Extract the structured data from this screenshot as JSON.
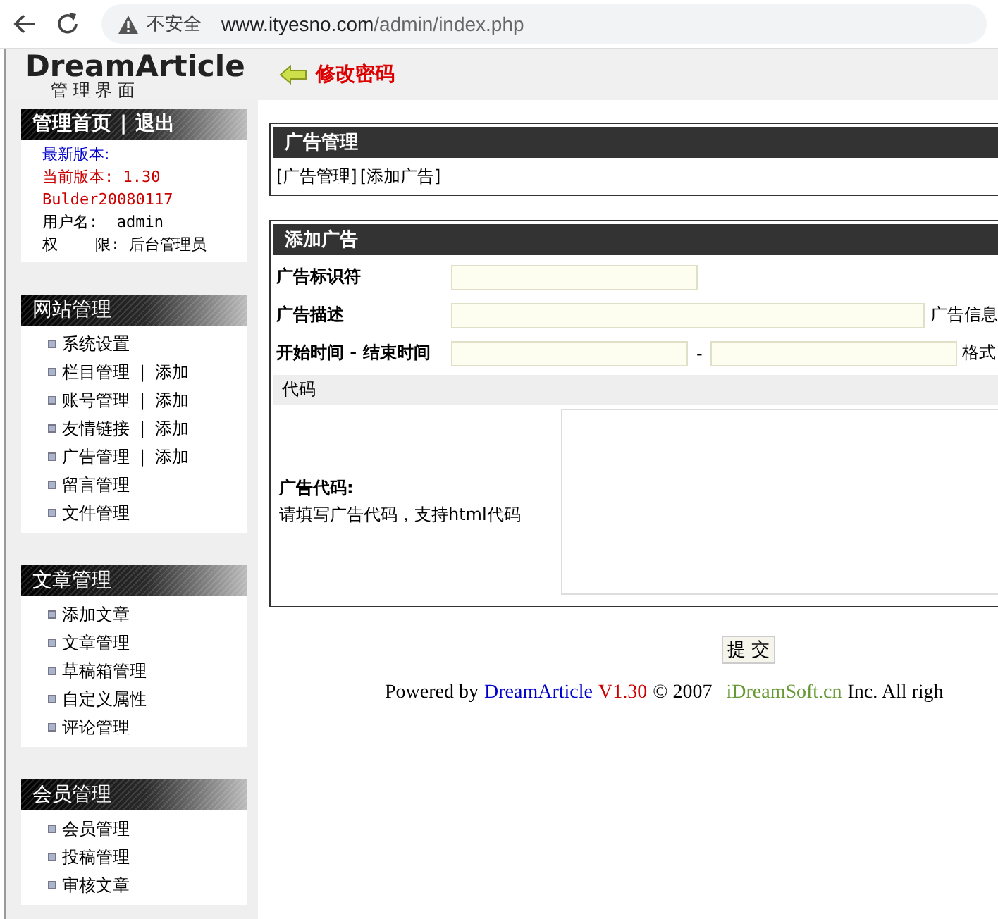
{
  "browser": {
    "security_label": "不安全",
    "url_host": "www.ityesno.com",
    "url_path": "/admin/index.php"
  },
  "header": {
    "logo": "DreamArticle",
    "logo_subtitle": "管 理 界 面",
    "change_password": "修改密码"
  },
  "sidebar": {
    "top_links": [
      {
        "label": "管理首页"
      },
      {
        "label": "退出"
      }
    ],
    "top_separator": "|",
    "info": [
      {
        "kind": "latest",
        "text": "最新版本:"
      },
      {
        "kind": "current",
        "text": "当前版本: 1.30"
      },
      {
        "kind": "build",
        "text": "Bulder20080117"
      },
      {
        "kind": "plain",
        "text": "用户名:  admin"
      },
      {
        "kind": "plain",
        "text": "权    限: 后台管理员"
      }
    ],
    "sections": [
      {
        "title": "网站管理",
        "items": [
          {
            "label": "系统设置"
          },
          {
            "label": "栏目管理",
            "separator": "|",
            "add": "添加"
          },
          {
            "label": "账号管理",
            "separator": "|",
            "add": "添加"
          },
          {
            "label": "友情链接",
            "separator": "|",
            "add": "添加"
          },
          {
            "label": "广告管理",
            "separator": "|",
            "add": "添加"
          },
          {
            "label": "留言管理"
          },
          {
            "label": "文件管理"
          }
        ]
      },
      {
        "title": "文章管理",
        "items": [
          {
            "label": "添加文章"
          },
          {
            "label": "文章管理"
          },
          {
            "label": "草稿箱管理"
          },
          {
            "label": "自定义属性"
          },
          {
            "label": "评论管理"
          }
        ]
      },
      {
        "title": "会员管理",
        "items": [
          {
            "label": "会员管理"
          },
          {
            "label": "投稿管理"
          },
          {
            "label": "审核文章"
          }
        ]
      }
    ]
  },
  "main": {
    "manage_panel": {
      "title": "广告管理",
      "links": [
        "[广告管理]",
        "[添加广告]"
      ]
    },
    "form_panel": {
      "title": "添加广告",
      "rows": [
        {
          "kind": "single",
          "label": "广告标识符"
        },
        {
          "kind": "described",
          "label": "广告描述",
          "note": "广告信息"
        },
        {
          "kind": "range",
          "label": "开始时间 - 结束时间",
          "dash": "-",
          "note": "格式"
        }
      ],
      "section_band": "代码",
      "code_label": "广告代码:",
      "code_hint": "请填写广告代码，支持html代码"
    },
    "submit": "提 交",
    "footer": {
      "powered": "Powered by",
      "product": "DreamArticle",
      "version": "V1.30",
      "year": "© 2007",
      "company": "iDreamSoft.cn",
      "rest": "Inc. All righ"
    }
  }
}
